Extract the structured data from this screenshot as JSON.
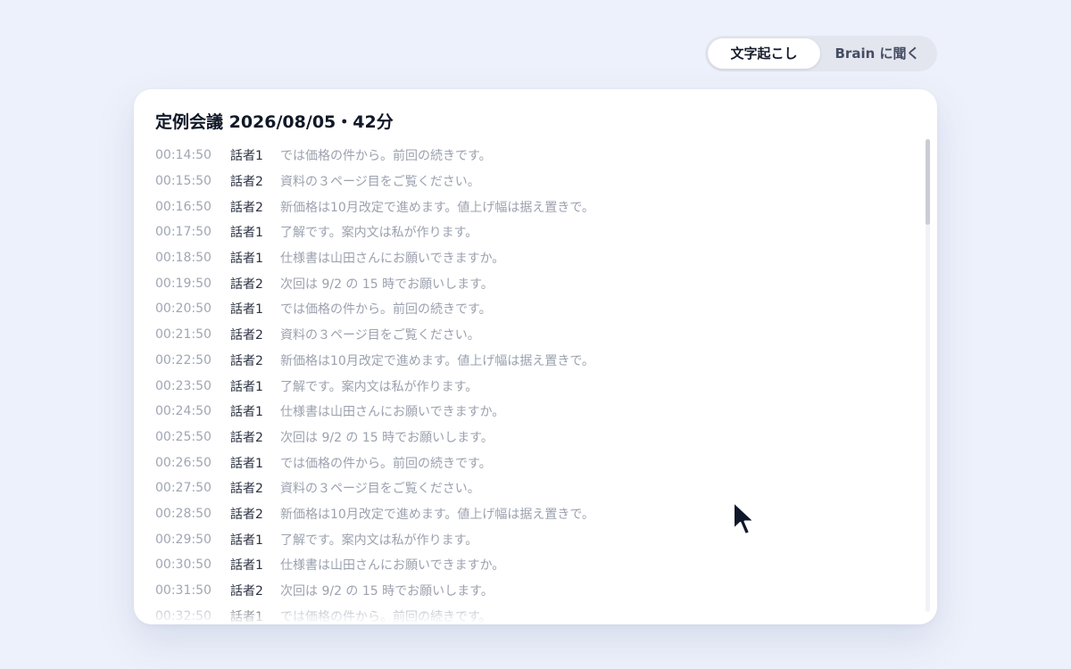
{
  "view_toggle": {
    "active_label": "文字起こし",
    "inactive_label": "Brain に聞く"
  },
  "meeting": {
    "title": "定例会議 2026/08/05・42分"
  },
  "transcript": [
    {
      "time": "00:14:50",
      "speaker": "話者1",
      "text": "では価格の件から。前回の続きです。"
    },
    {
      "time": "00:15:50",
      "speaker": "話者2",
      "text": "資料の３ページ目をご覧ください。"
    },
    {
      "time": "00:16:50",
      "speaker": "話者2",
      "text": "新価格は10月改定で進めます。値上げ幅は据え置きで。"
    },
    {
      "time": "00:17:50",
      "speaker": "話者1",
      "text": "了解です。案内文は私が作ります。"
    },
    {
      "time": "00:18:50",
      "speaker": "話者1",
      "text": "仕様書は山田さんにお願いできますか。"
    },
    {
      "time": "00:19:50",
      "speaker": "話者2",
      "text": "次回は 9/2 の 15 時でお願いします。"
    },
    {
      "time": "00:20:50",
      "speaker": "話者1",
      "text": "では価格の件から。前回の続きです。"
    },
    {
      "time": "00:21:50",
      "speaker": "話者2",
      "text": "資料の３ページ目をご覧ください。"
    },
    {
      "time": "00:22:50",
      "speaker": "話者2",
      "text": "新価格は10月改定で進めます。値上げ幅は据え置きで。"
    },
    {
      "time": "00:23:50",
      "speaker": "話者1",
      "text": "了解です。案内文は私が作ります。"
    },
    {
      "time": "00:24:50",
      "speaker": "話者1",
      "text": "仕様書は山田さんにお願いできますか。"
    },
    {
      "time": "00:25:50",
      "speaker": "話者2",
      "text": "次回は 9/2 の 15 時でお願いします。"
    },
    {
      "time": "00:26:50",
      "speaker": "話者1",
      "text": "では価格の件から。前回の続きです。"
    },
    {
      "time": "00:27:50",
      "speaker": "話者2",
      "text": "資料の３ページ目をご覧ください。"
    },
    {
      "time": "00:28:50",
      "speaker": "話者2",
      "text": "新価格は10月改定で進めます。値上げ幅は据え置きで。"
    },
    {
      "time": "00:29:50",
      "speaker": "話者1",
      "text": "了解です。案内文は私が作ります。"
    },
    {
      "time": "00:30:50",
      "speaker": "話者1",
      "text": "仕様書は山田さんにお願いできますか。"
    },
    {
      "time": "00:31:50",
      "speaker": "話者2",
      "text": "次回は 9/2 の 15 時でお願いします。"
    },
    {
      "time": "00:32:50",
      "speaker": "話者1",
      "text": "では価格の件から。前回の続きです。"
    }
  ],
  "scroll": {
    "position_fraction": 0.0
  },
  "pointer": {
    "icon": "mouse-pointer-icon"
  }
}
